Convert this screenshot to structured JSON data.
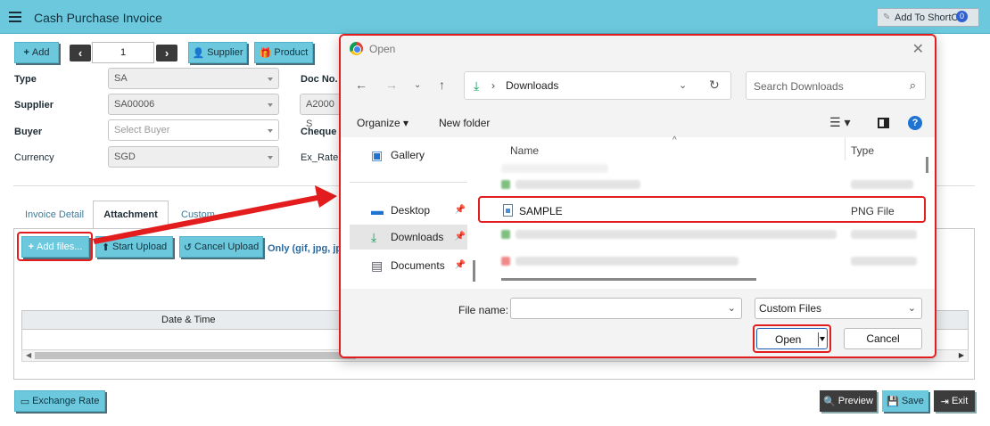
{
  "header": {
    "title": "Cash Purchase Invoice",
    "shortcut_label": "Add To ShortCut",
    "shortcut_badge": "0"
  },
  "toolbar": {
    "add_label": "Add",
    "prev_glyph": "‹",
    "next_glyph": "›",
    "page_number": "1",
    "supplier_label": "Supplier",
    "product_label": "Product"
  },
  "form": {
    "type_label": "Type",
    "type_value": "SA",
    "supplier_label": "Supplier",
    "supplier_value": "SA00006",
    "buyer_label": "Buyer",
    "buyer_placeholder": "Select Buyer",
    "currency_label": "Currency",
    "currency_value": "SGD",
    "docno_label": "Doc No.",
    "docno_value": "A2000 S",
    "cheque_label": "Cheque N",
    "exrate_label": "Ex_Rate"
  },
  "tabs": {
    "invoice_detail": "Invoice Detail",
    "attachment": "Attachment",
    "custom": "Custom"
  },
  "attachment": {
    "add_files_label": "Add files...",
    "start_upload_label": "Start Upload",
    "cancel_upload_label": "Cancel Upload",
    "only_text": "Only (gif, jpg, jp",
    "col_datetime": "Date & Time"
  },
  "footer": {
    "exchange_rate_label": "Exchange Rate",
    "preview_label": "Preview",
    "save_label": "Save",
    "exit_label": "Exit"
  },
  "dialog": {
    "title": "Open",
    "path": "Downloads",
    "search_placeholder": "Search Downloads",
    "organize_label": "Organize",
    "new_folder_label": "New folder",
    "nav_items": [
      {
        "label": "Gallery"
      },
      {
        "label": "Desktop"
      },
      {
        "label": "Downloads"
      },
      {
        "label": "Documents"
      }
    ],
    "col_name": "Name",
    "col_type": "Type",
    "selected_file_name": "SAMPLE",
    "selected_file_type": "PNG File",
    "filename_label": "File name:",
    "filename_value": "",
    "filter_value": "Custom Files",
    "open_label": "Open",
    "cancel_label": "Cancel"
  },
  "colors": {
    "accent": "#6cc9dd",
    "highlight_red": "#e31d1d",
    "dark_button": "#3c3c3c"
  }
}
